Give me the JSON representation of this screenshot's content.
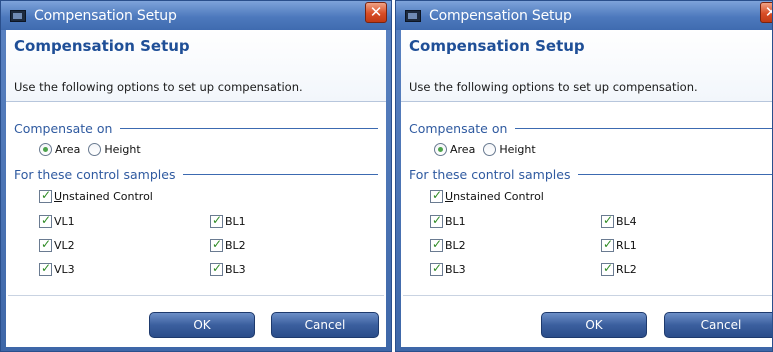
{
  "dialogs": [
    {
      "window_title": "Compensation Setup",
      "close_glyph": "✕",
      "header_title": "Compensation Setup",
      "description": "Use the following options to set up compensation.",
      "compensate_on_label": "Compensate on",
      "radio_options": [
        {
          "label": "Area",
          "selected": true
        },
        {
          "label": "Height",
          "selected": false
        }
      ],
      "samples_label": "For these control samples",
      "unstained_label": "nstained Control",
      "unstained_first_letter": "U",
      "samples_left": [
        "VL1",
        "VL2",
        "VL3"
      ],
      "samples_right": [
        "BL1",
        "BL2",
        "BL3"
      ],
      "ok_label": "OK",
      "cancel_label": "Cancel"
    },
    {
      "window_title": "Compensation Setup",
      "close_glyph": "✕",
      "header_title": "Compensation Setup",
      "description": "Use the following options to set up compensation.",
      "compensate_on_label": "Compensate on",
      "radio_options": [
        {
          "label": "Area",
          "selected": true
        },
        {
          "label": "Height",
          "selected": false
        }
      ],
      "samples_label": "For these control samples",
      "unstained_label": "nstained Control",
      "unstained_first_letter": "U",
      "samples_left": [
        "BL1",
        "BL2",
        "BL3"
      ],
      "samples_right": [
        "BL4",
        "RL1",
        "RL2"
      ],
      "ok_label": "OK",
      "cancel_label": "Cancel"
    }
  ],
  "check_glyph": "✓",
  "colors": {
    "title_bar": "#4d79bd",
    "header_title": "#1f4f97",
    "section_label": "#2f5aa0",
    "button": "#3b5f9e",
    "close_button": "#d84d26"
  }
}
